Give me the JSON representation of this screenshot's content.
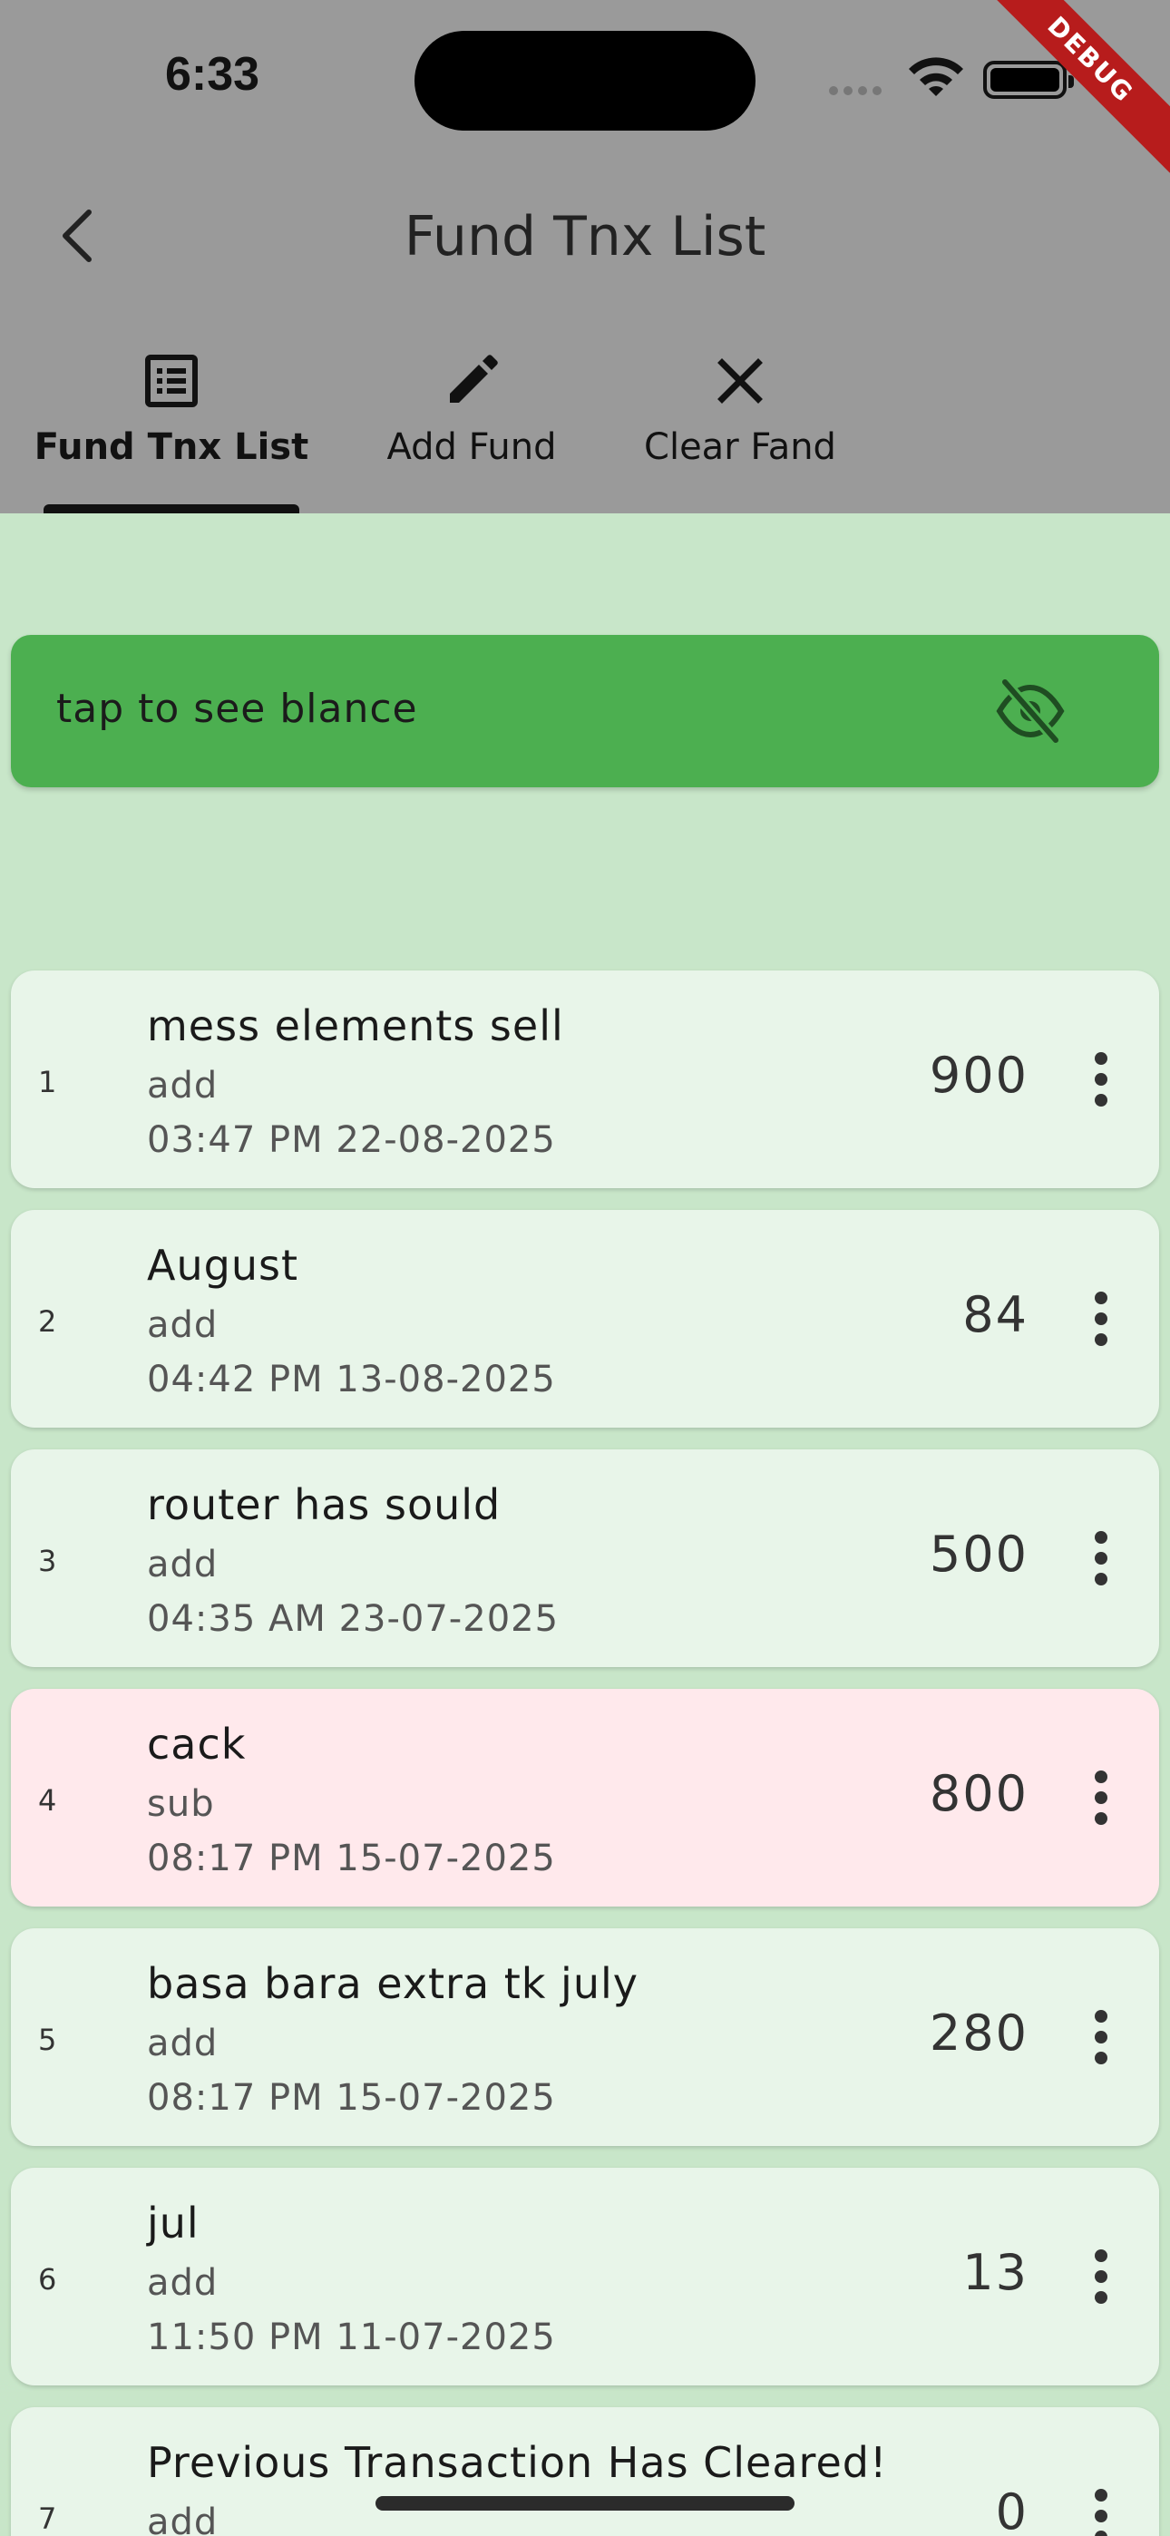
{
  "status_bar": {
    "time": "6:33",
    "debug_banner": "DEBUG"
  },
  "appbar": {
    "title": "Fund Tnx List",
    "back_icon": "chevron-left-icon"
  },
  "tabs": [
    {
      "label": "Fund Tnx List",
      "icon": "list-icon",
      "active": true
    },
    {
      "label": "Add Fund",
      "icon": "pencil-icon",
      "active": false
    },
    {
      "label": "Clear Fand",
      "icon": "close-icon",
      "active": false
    }
  ],
  "balance": {
    "text": "tap to see blance",
    "icon": "eye-off-icon",
    "color": "#4caf50"
  },
  "transactions": [
    {
      "index": "1",
      "title": "mess elements sell",
      "type": "add",
      "datetime": "03:47 PM 22-08-2025",
      "amount": "900"
    },
    {
      "index": "2",
      "title": "August",
      "type": "add",
      "datetime": "04:42 PM 13-08-2025",
      "amount": "84"
    },
    {
      "index": "3",
      "title": "router has sould",
      "type": "add",
      "datetime": "04:35 AM 23-07-2025",
      "amount": "500"
    },
    {
      "index": "4",
      "title": "cack",
      "type": "sub",
      "datetime": "08:17 PM 15-07-2025",
      "amount": "800"
    },
    {
      "index": "5",
      "title": "basa bara extra tk july",
      "type": "add",
      "datetime": "08:17 PM 15-07-2025",
      "amount": "280"
    },
    {
      "index": "6",
      "title": "jul",
      "type": "add",
      "datetime": "11:50 PM 11-07-2025",
      "amount": "13"
    },
    {
      "index": "7",
      "title": "Previous Transaction Has Cleared!",
      "type": "add",
      "datetime": "",
      "amount": "0"
    }
  ],
  "colors": {
    "appbar": "#9a9a9a",
    "background": "#c8e6c9",
    "card_add": "#e8f5e9",
    "card_sub": "#ffe9ec"
  }
}
